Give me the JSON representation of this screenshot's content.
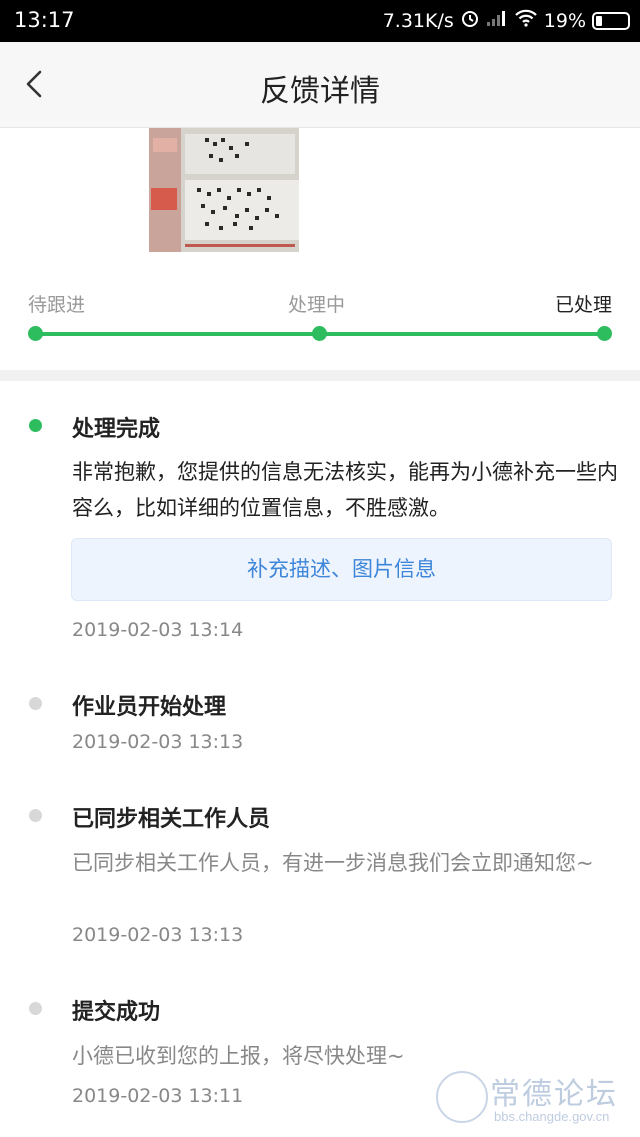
{
  "status_bar": {
    "time": "13:17",
    "network_speed": "7.31K/s",
    "battery": "19%",
    "icons": [
      "alarm-icon",
      "signal-icon",
      "wifi-icon",
      "battery-icon"
    ]
  },
  "header": {
    "title": "反馈详情",
    "back_icon": "chevron-left-icon"
  },
  "progress": {
    "steps": [
      "待跟进",
      "处理中",
      "已处理"
    ],
    "current_step": 3,
    "accent_color": "#2dbd5f"
  },
  "timeline": [
    {
      "title": "处理完成",
      "text": "非常抱歉，您提供的信息无法核实，能再为小德补充一些内容么，比如详细的位置信息，不胜感激。",
      "action_label": "补充描述、图片信息",
      "time": "2019-02-03 13:14",
      "active": true
    },
    {
      "title": "作业员开始处理",
      "time": "2019-02-03 13:13",
      "active": false
    },
    {
      "title": "已同步相关工作人员",
      "text": "已同步相关工作人员，有进一步消息我们会立即通知您~",
      "time": "2019-02-03 13:13",
      "active": false
    },
    {
      "title": "提交成功",
      "text": "小德已收到您的上报，将尽快处理~",
      "time": "2019-02-03 13:11",
      "active": false
    }
  ],
  "watermark": {
    "text": "常德论坛",
    "url": "bbs.changde.gov.cn"
  }
}
